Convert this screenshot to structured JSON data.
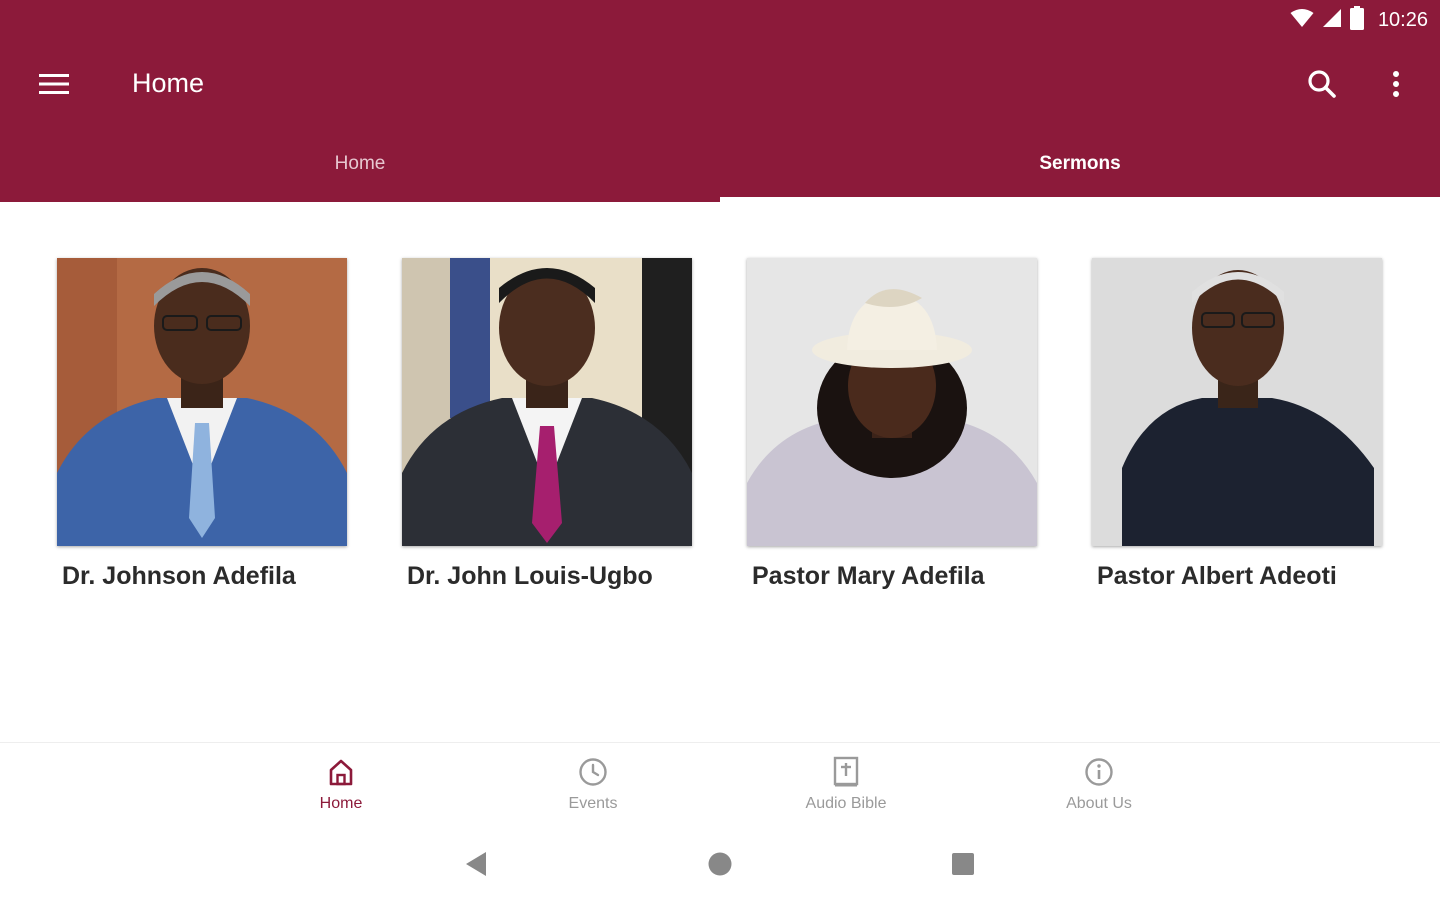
{
  "status_bar": {
    "time": "10:26",
    "wifi_icon": "wifi-icon",
    "signal_icon": "cell-signal-icon",
    "battery_icon": "battery-icon"
  },
  "app_bar": {
    "title": "Home",
    "menu_icon": "hamburger-menu-icon",
    "search_icon": "search-icon",
    "overflow_icon": "more-vert-icon"
  },
  "tabs": [
    {
      "label": "Home",
      "selected": false
    },
    {
      "label": "Sermons",
      "selected": true
    }
  ],
  "speakers": [
    {
      "name": "Dr. Johnson Adefila"
    },
    {
      "name": "Dr. John Louis-Ugbo"
    },
    {
      "name": "Pastor Mary Adefila"
    },
    {
      "name": "Pastor Albert Adeoti"
    }
  ],
  "bottom_nav": [
    {
      "label": "Home",
      "icon": "home-icon",
      "active": true
    },
    {
      "label": "Events",
      "icon": "clock-icon",
      "active": false
    },
    {
      "label": "Audio Bible",
      "icon": "bible-icon",
      "active": false
    },
    {
      "label": "About Us",
      "icon": "info-icon",
      "active": false
    }
  ],
  "system_nav": {
    "back_icon": "back-triangle-icon",
    "home_icon": "home-circle-icon",
    "recents_icon": "recents-square-icon"
  },
  "colors": {
    "primary": "#8c1a3a",
    "active_nav": "#8c1a3a",
    "inactive_nav": "#9a9a9a"
  }
}
